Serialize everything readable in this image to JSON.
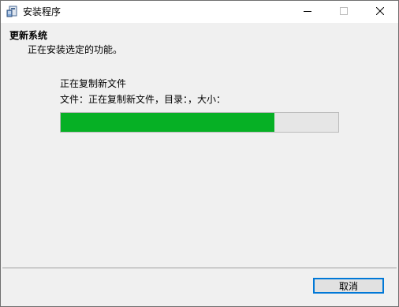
{
  "window": {
    "title": "安装程序",
    "icon": "installer-icon",
    "controls": [
      "minimize-icon",
      "maximize-icon",
      "close-icon"
    ]
  },
  "header": {
    "title": "更新系统",
    "subtitle": "正在安装选定的功能。"
  },
  "main": {
    "status": "正在复制新文件",
    "detail": "文件：正在复制新文件，目录：，大小：",
    "progress": 0.77
  },
  "footer": {
    "cancel_label": "取消"
  },
  "colors": {
    "progress_fill": "#06b025",
    "progress_track": "#e6e6e6",
    "focus_border": "#0078d7"
  }
}
